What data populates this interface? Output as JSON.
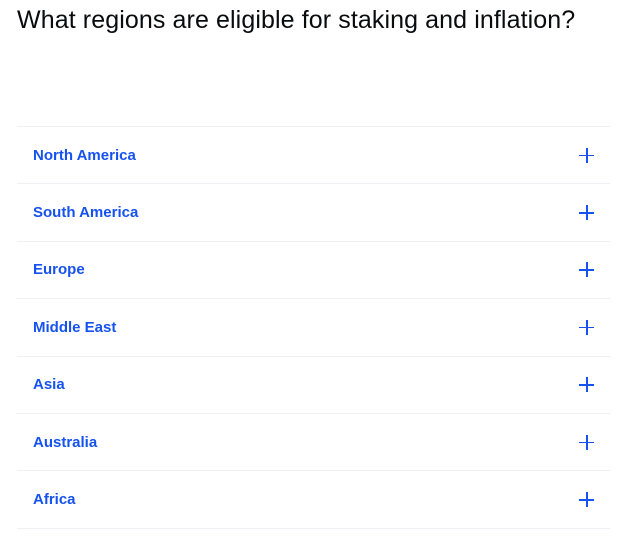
{
  "title": "What regions are eligible for staking and inflation?",
  "regions": [
    {
      "label": "North America",
      "icon": "plus-icon"
    },
    {
      "label": "South America",
      "icon": "plus-icon"
    },
    {
      "label": "Europe",
      "icon": "plus-icon"
    },
    {
      "label": "Middle East",
      "icon": "plus-icon"
    },
    {
      "label": "Asia",
      "icon": "plus-icon"
    },
    {
      "label": "Australia",
      "icon": "plus-icon"
    },
    {
      "label": "Africa",
      "icon": "plus-icon"
    }
  ],
  "colors": {
    "accent": "#1652f0",
    "text": "#0a0b0d",
    "divider": "#eef0f3"
  }
}
